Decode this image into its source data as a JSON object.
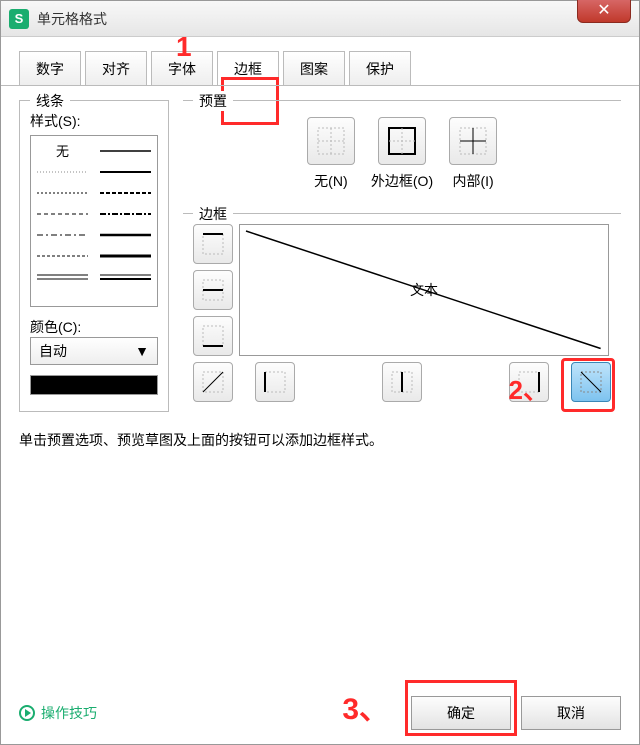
{
  "title": "单元格格式",
  "close_glyph": "✕",
  "tabs": [
    "数字",
    "对齐",
    "字体",
    "边框",
    "图案",
    "保护"
  ],
  "active_tab_index": 3,
  "annotations": {
    "marker1": "1",
    "marker2": "2、",
    "marker3": "3、"
  },
  "line": {
    "group_label": "线条",
    "style_label": "样式(S):",
    "none_label": "无",
    "color_label": "颜色(C):",
    "color_value": "自动"
  },
  "preset": {
    "group_label": "预置",
    "items": [
      {
        "key": "none",
        "label": "无(N)"
      },
      {
        "key": "outline",
        "label": "外边框(O)"
      },
      {
        "key": "inside",
        "label": "内部(I)"
      }
    ]
  },
  "border": {
    "group_label": "边框",
    "preview_text": "文本",
    "side_buttons": [
      "top",
      "mid-h",
      "bottom"
    ],
    "bottom_buttons": [
      "diag-up",
      "left",
      "mid-v",
      "right",
      "diag-down"
    ],
    "selected_index": 4
  },
  "help_text": "单击预置选项、预览草图及上面的按钮可以添加边框样式。",
  "footer": {
    "tips": "操作技巧",
    "ok": "确定",
    "cancel": "取消"
  }
}
